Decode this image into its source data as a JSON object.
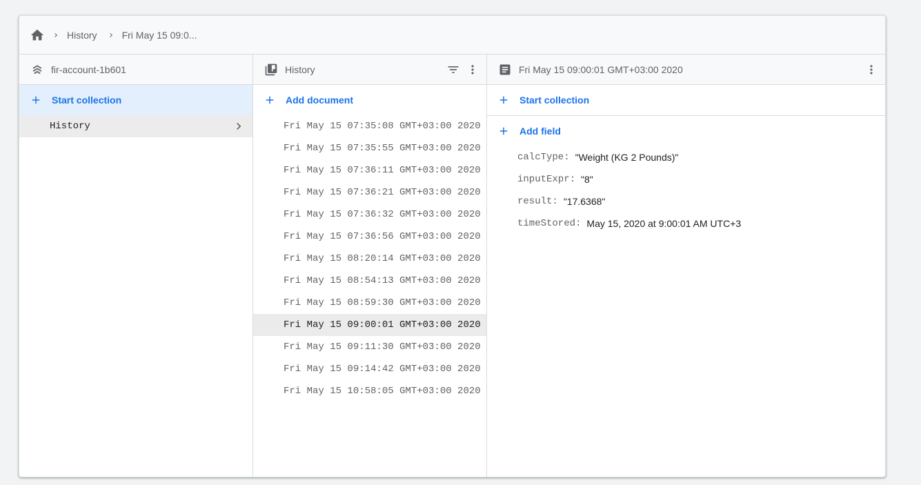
{
  "breadcrumb": {
    "home_icon": "home-icon",
    "items": [
      "History",
      "Fri May 15 09:0..."
    ]
  },
  "root": {
    "project": "fir-account-1b601",
    "start_collection": "Start collection",
    "collections": [
      "History"
    ]
  },
  "collection": {
    "title": "History",
    "add_document": "Add document",
    "documents": [
      "Fri May 15 07:35:08 GMT+03:00 2020",
      "Fri May 15 07:35:55 GMT+03:00 2020",
      "Fri May 15 07:36:11 GMT+03:00 2020",
      "Fri May 15 07:36:21 GMT+03:00 2020",
      "Fri May 15 07:36:32 GMT+03:00 2020",
      "Fri May 15 07:36:56 GMT+03:00 2020",
      "Fri May 15 08:20:14 GMT+03:00 2020",
      "Fri May 15 08:54:13 GMT+03:00 2020",
      "Fri May 15 08:59:30 GMT+03:00 2020",
      "Fri May 15 09:00:01 GMT+03:00 2020",
      "Fri May 15 09:11:30 GMT+03:00 2020",
      "Fri May 15 09:14:42 GMT+03:00 2020",
      "Fri May 15 10:58:05 GMT+03:00 2020"
    ],
    "selected_index": 9
  },
  "document": {
    "title": "Fri May 15 09:00:01 GMT+03:00 2020",
    "start_collection": "Start collection",
    "add_field": "Add field",
    "fields": [
      {
        "key": "calcType:",
        "value": "\"Weight (KG 2 Pounds)\""
      },
      {
        "key": "inputExpr:",
        "value": "\"8\""
      },
      {
        "key": "result:",
        "value": "\"17.6368\""
      },
      {
        "key": "timeStored:",
        "value": "May 15, 2020 at 9:00:01 AM UTC+3"
      }
    ]
  },
  "colors": {
    "accent": "#1a73e8",
    "selected_bg": "#ebebeb",
    "active_row_bg": "#e3effc"
  }
}
